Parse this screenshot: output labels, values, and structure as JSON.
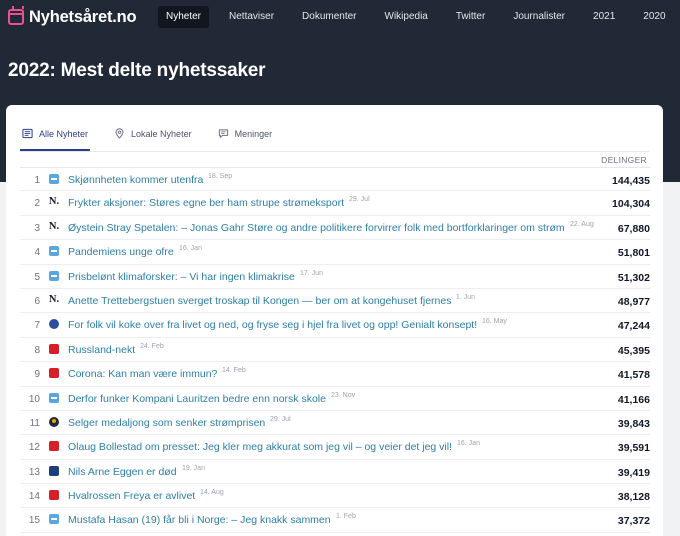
{
  "site": {
    "name": "Nyhetsåret.no",
    "logo_color": "#e8548e"
  },
  "nav": {
    "items": [
      {
        "label": "Nyheter",
        "active": true
      },
      {
        "label": "Nettaviser",
        "active": false
      },
      {
        "label": "Dokumenter",
        "active": false
      },
      {
        "label": "Wikipedia",
        "active": false
      },
      {
        "label": "Twitter",
        "active": false
      },
      {
        "label": "Journalister",
        "active": false
      },
      {
        "label": "2021",
        "active": false
      },
      {
        "label": "2020",
        "active": false
      }
    ]
  },
  "page": {
    "title": "2022: Mest delte nyhetssaker"
  },
  "tabs": [
    {
      "label": "Alle Nyheter",
      "icon": "newspaper-icon",
      "active": true
    },
    {
      "label": "Lokale Nyheter",
      "icon": "map-pin-icon",
      "active": false
    },
    {
      "label": "Meninger",
      "icon": "chat-bubble-icon",
      "active": false
    }
  ],
  "table": {
    "column_header": "DELINGER",
    "rows": [
      {
        "rank": "1",
        "source_icon": "nrk-icon",
        "title": "Skjønnheten kommer utenfra",
        "date": "18. Sep",
        "count": "144,435"
      },
      {
        "rank": "2",
        "source_icon": "n-logo-icon",
        "title": "Frykter aksjoner: Støres egne ber ham strupe strømeksport",
        "date": "29. Jul",
        "count": "104,304"
      },
      {
        "rank": "3",
        "source_icon": "n-logo-icon",
        "title": "Øystein Stray Spetalen: – Jonas Gahr Støre og andre politikere forvirrer folk med bortforklaringer om strøm",
        "date": "22. Aug",
        "count": "67,880"
      },
      {
        "rank": "4",
        "source_icon": "nrk-icon",
        "title": "Pandemiens unge ofre",
        "date": "16. Jan",
        "count": "51,801"
      },
      {
        "rank": "5",
        "source_icon": "nrk-icon",
        "title": "Prisbelønt klimaforsker: – Vi har ingen klimakrise",
        "date": "17. Jun",
        "count": "51,302"
      },
      {
        "rank": "6",
        "source_icon": "n-logo-icon",
        "title": "Anette Trettebergstuen sverget troskap til Kongen — ber om at kongehuset fjernes",
        "date": "1. Jun",
        "count": "48,977"
      },
      {
        "rank": "7",
        "source_icon": "circle-logo-icon",
        "title": "For folk vil koke over fra livet og ned, og fryse seg i hjel fra livet og opp! Genialt konsept!",
        "date": "16. May",
        "count": "47,244"
      },
      {
        "rank": "8",
        "source_icon": "vg-icon",
        "title": "Russland-nekt",
        "date": "24. Feb",
        "count": "45,395"
      },
      {
        "rank": "9",
        "source_icon": "vg-icon",
        "title": "Corona: Kan man være immun?",
        "date": "14. Feb",
        "count": "41,578"
      },
      {
        "rank": "10",
        "source_icon": "nrk-icon",
        "title": "Derfor funker Kompani Lauritzen bedre enn norsk skole",
        "date": "23. Nov",
        "count": "41,166"
      },
      {
        "rank": "11",
        "source_icon": "blob-logo-icon",
        "title": "Selger medaljong som senker strømprisen",
        "date": "29. Jul",
        "count": "39,843"
      },
      {
        "rank": "12",
        "source_icon": "vg-icon",
        "title": "Olaug Bollestad om presset: Jeg kler meg akkurat som jeg vil – og veier det jeg vil!",
        "date": "16. Jan",
        "count": "39,591"
      },
      {
        "rank": "13",
        "source_icon": "dagbladet-icon",
        "title": "Nils Arne Eggen er død",
        "date": "19. Jan",
        "count": "39,419"
      },
      {
        "rank": "14",
        "source_icon": "vg-icon",
        "title": "Hvalrossen Freya er avlivet",
        "date": "14. Aug",
        "count": "38,128"
      },
      {
        "rank": "15",
        "source_icon": "nrk-icon",
        "title": "Mustafa Hasan (19) får bli i Norge: – Jeg knakk sammen",
        "date": "1. Feb",
        "count": "37,372"
      }
    ]
  }
}
